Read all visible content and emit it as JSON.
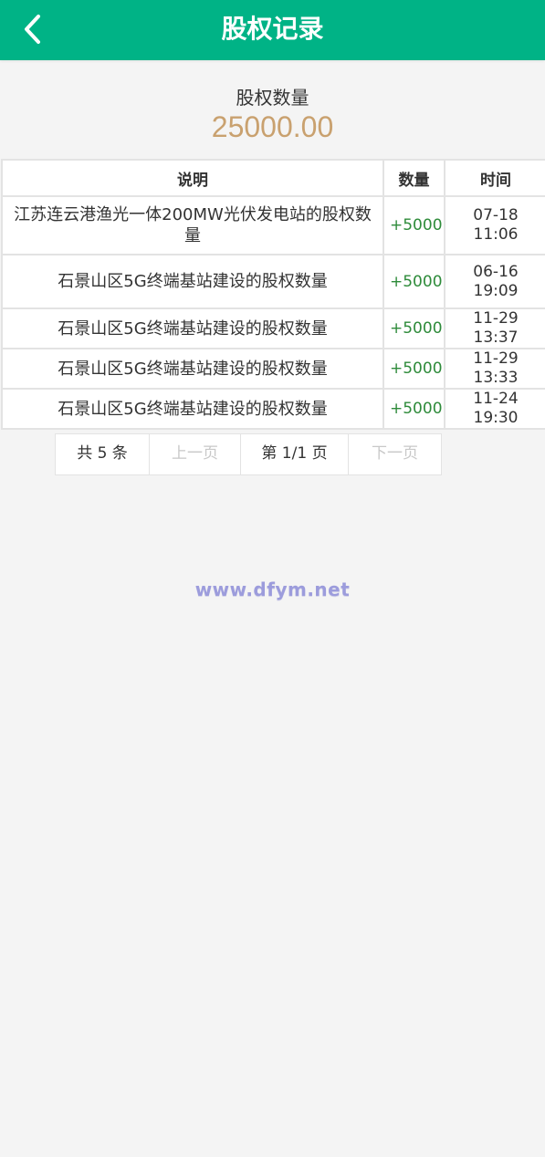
{
  "header": {
    "title": "股权记录",
    "back_icon": "chevron-left-icon",
    "background": "#00b386"
  },
  "summary": {
    "label": "股权数量",
    "value": "25000.00",
    "value_color": "#c9a16f"
  },
  "table": {
    "headers": {
      "desc": "说明",
      "amount": "数量",
      "time": "时间"
    },
    "rows": [
      {
        "desc": "江苏连云港渔光一体200MW光伏发电站的股权数量",
        "amount": "+5000",
        "time": "07-18 11:06"
      },
      {
        "desc": "石景山区5G终端基站建设的股权数量",
        "amount": "+5000",
        "time": "06-16 19:09"
      },
      {
        "desc": "石景山区5G终端基站建设的股权数量",
        "amount": "+5000",
        "time": "11-29 13:37"
      },
      {
        "desc": "石景山区5G终端基站建设的股权数量",
        "amount": "+5000",
        "time": "11-29 13:33"
      },
      {
        "desc": "石景山区5G终端基站建设的股权数量",
        "amount": "+5000",
        "time": "11-24 19:30"
      }
    ],
    "amount_color": "#2e8b3a"
  },
  "pager": {
    "total": "共 5 条",
    "prev": "上一页",
    "page": "第 1/1 页",
    "next": "下一页"
  },
  "watermark": "www.dfym.net"
}
